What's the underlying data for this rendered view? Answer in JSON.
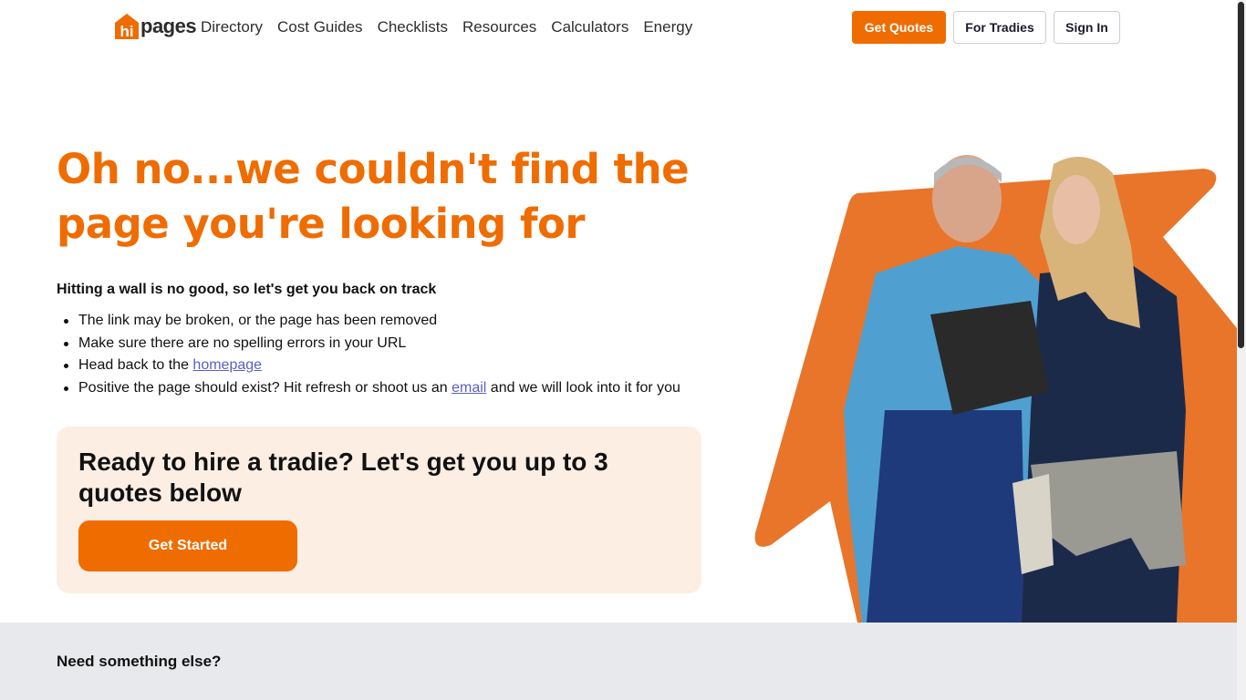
{
  "header": {
    "logo_text": "pages",
    "logo_mark": "hi",
    "nav": [
      "Directory",
      "Cost Guides",
      "Checklists",
      "Resources",
      "Calculators",
      "Energy"
    ],
    "get_quotes": "Get Quotes",
    "for_tradies": "For Tradies",
    "sign_in": "Sign In"
  },
  "hero": {
    "headline": "Oh no...we couldn't find the page you're looking for",
    "subhead": "Hitting a wall is no good, so let's get you back on track",
    "tips": [
      {
        "text": "The link may be broken, or the page has been removed"
      },
      {
        "text": "Make sure there are no spelling errors in your URL"
      },
      {
        "before": "Head back to the ",
        "link": "homepage",
        "after": ""
      },
      {
        "before": "Positive the page should exist? Hit refresh or shoot us an ",
        "link": "email",
        "after": " and we will look into it for you"
      }
    ]
  },
  "cta": {
    "title": "Ready to hire a tradie? Let's get you up to 3 quotes below",
    "button": "Get Started"
  },
  "footer": {
    "title": "Need something else?"
  },
  "colors": {
    "brand_orange": "#ef6c00",
    "cta_bg": "#fdeee4",
    "footer_bg": "#e8e9ec",
    "link": "#5a5fc4"
  },
  "icons": {
    "logo": "hipages-house-logo",
    "hero": "two-tradespeople-with-tablet-photo"
  }
}
